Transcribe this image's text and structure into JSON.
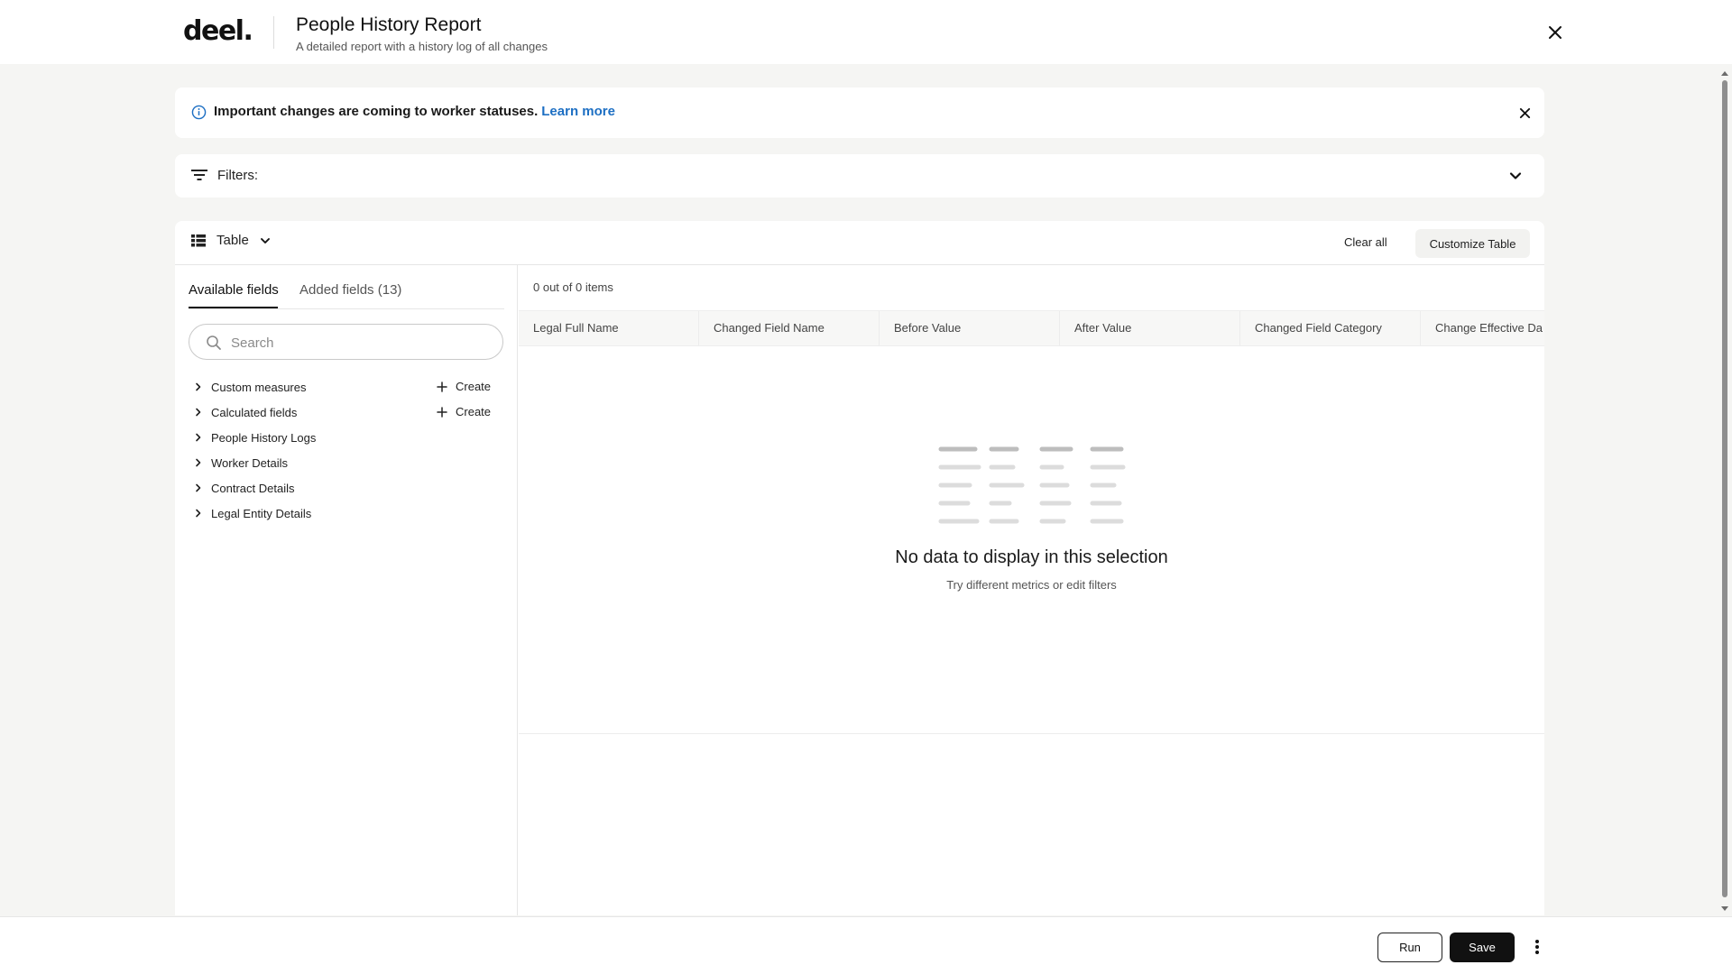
{
  "header": {
    "logo": "deel.",
    "title": "People History Report",
    "subtitle": "A detailed report with a history log of all changes"
  },
  "banner": {
    "message": "Important changes are coming to worker statuses.",
    "link": "Learn more"
  },
  "filters": {
    "label": "Filters:"
  },
  "toolbar": {
    "view_label": "Table",
    "clear_all": "Clear all",
    "customize": "Customize Table"
  },
  "fields_panel": {
    "tabs": [
      {
        "label": "Available fields",
        "active": true
      },
      {
        "label": "Added fields (13)",
        "active": false
      }
    ],
    "search_placeholder": "Search",
    "create_label": "Create",
    "groups": [
      {
        "label": "Custom measures",
        "creatable": true
      },
      {
        "label": "Calculated fields",
        "creatable": true
      },
      {
        "label": "People History Logs",
        "creatable": false
      },
      {
        "label": "Worker Details",
        "creatable": false
      },
      {
        "label": "Contract Details",
        "creatable": false
      },
      {
        "label": "Legal Entity Details",
        "creatable": false
      }
    ]
  },
  "results": {
    "item_count": "0 out of 0 items",
    "columns": [
      "Legal Full Name",
      "Changed Field Name",
      "Before Value",
      "After Value",
      "Changed Field Category",
      "Change Effective Da"
    ],
    "empty_title": "No data to display in this selection",
    "empty_subtitle": "Try different metrics or edit filters"
  },
  "footer": {
    "run": "Run",
    "save": "Save"
  },
  "colors": {
    "link": "#1d6fc3",
    "primary": "#111111",
    "background": "#f5f5f3"
  },
  "icons": [
    "info-icon",
    "close-icon",
    "filter-icon",
    "chevron-down-icon",
    "table-icon",
    "search-icon",
    "chevron-right-icon",
    "plus-icon",
    "more-vertical-icon"
  ]
}
